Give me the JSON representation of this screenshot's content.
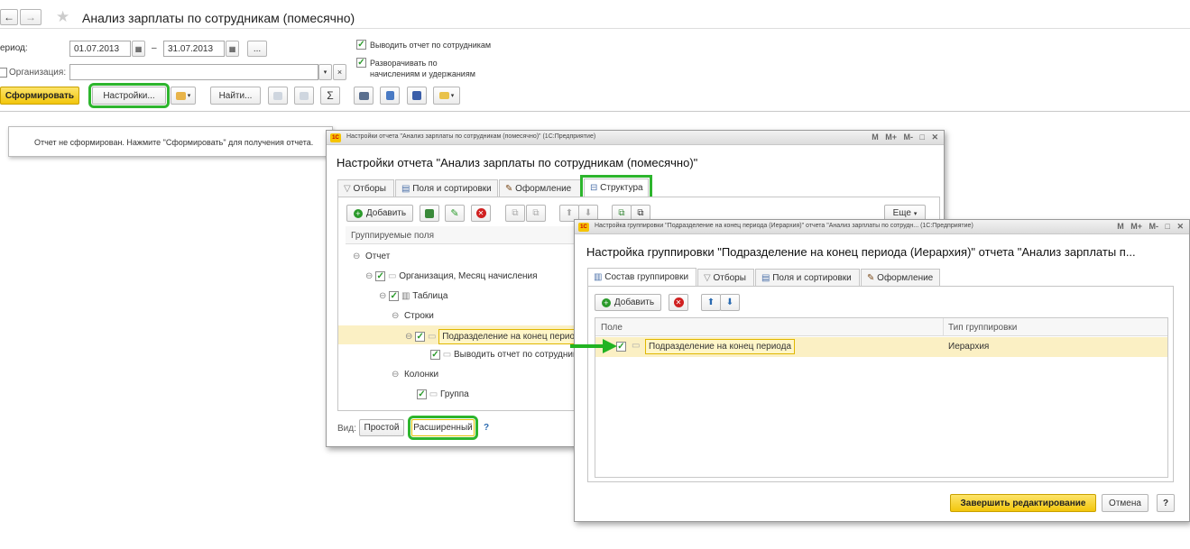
{
  "main": {
    "title": "Анализ зарплаты по сотрудникам (помесячно)",
    "period_label": "ериод:",
    "date_from": "01.07.2013",
    "date_sep": "–",
    "date_to": "31.07.2013",
    "dots": "...",
    "org_label": "Организация:",
    "org_value": "",
    "chk_employees": "Выводить отчет по сотрудникам",
    "chk_expand_1": "Разворачивать по",
    "chk_expand_2": "начислениям и удержаниям",
    "btn_generate": "Сформировать",
    "btn_settings": "Настройки...",
    "btn_find": "Найти...",
    "sigma": "Σ",
    "message": "Отчет не сформирован. Нажмите \"Сформировать\" для получения отчета."
  },
  "settings": {
    "titlebar": "Настройки отчета \"Анализ зарплаты по сотрудникам (помесячно)\"  (1С:Предприятие)",
    "heading": "Настройки отчета \"Анализ зарплаты по сотрудникам (помесячно)\"",
    "tabs": [
      "Отборы",
      "Поля и сортировки",
      "Оформление",
      "Структура"
    ],
    "btn_add": "Добавить",
    "btn_more": "Еще",
    "col_header": "Группируемые поля",
    "tree": [
      "Отчет",
      "Организация, Месяц начисления",
      "Таблица",
      "Строки",
      "Подразделение на конец периода",
      "Выводить отчет по сотрудникам",
      "Колонки",
      "Группа"
    ],
    "view_label": "Вид:",
    "btn_simple": "Простой",
    "btn_advanced": "Расширенный",
    "help": "?"
  },
  "grouping": {
    "titlebar": "Настройка группировки \"Подразделение на конец периода (Иерархия)\" отчета \"Анализ зарплаты по сотрудн...  (1С:Предприятие)",
    "heading": "Настройка группировки \"Подразделение на конец периода (Иерархия)\" отчета \"Анализ зарплаты п...",
    "tabs": [
      "Состав группировки",
      "Отборы",
      "Поля и сортировки",
      "Оформление"
    ],
    "btn_add": "Добавить",
    "col_field": "Поле",
    "col_type": "Тип группировки",
    "row_field": "Подразделение на конец периода",
    "row_type": "Иерархия",
    "btn_finish": "Завершить редактирование",
    "btn_cancel": "Отмена",
    "help": "?"
  },
  "winbuttons": [
    "M",
    "M+",
    "M-"
  ],
  "colors": {
    "accent_green": "#2db52d",
    "generate_yellow": "#f7d117",
    "highlight_row": "#fbf0c4"
  }
}
